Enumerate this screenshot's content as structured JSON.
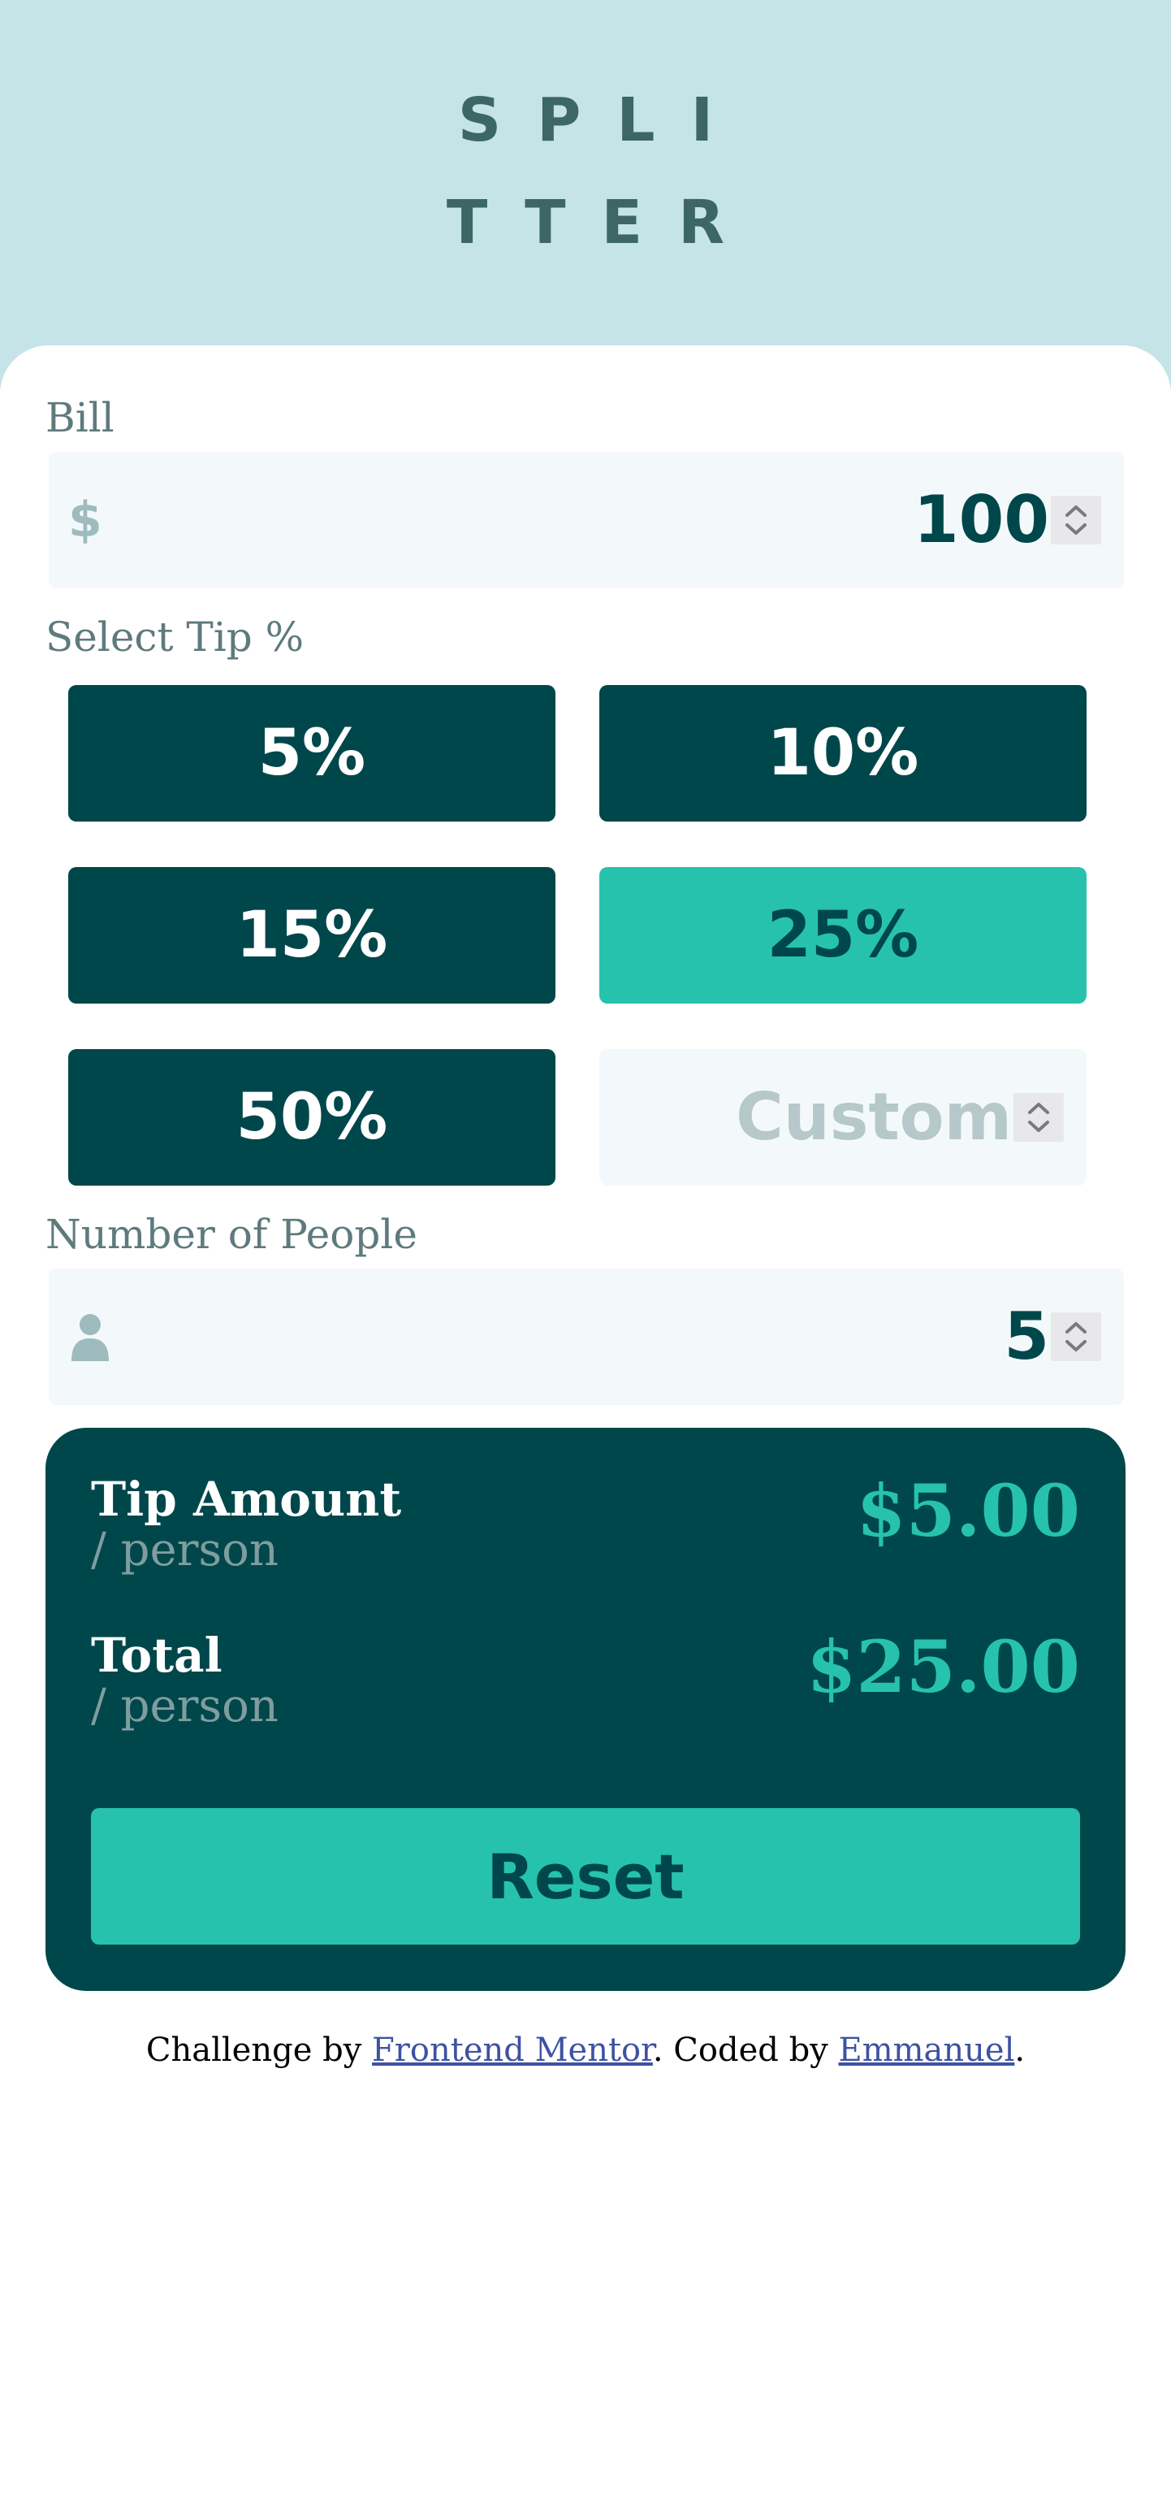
{
  "header": {
    "logo_line1": "SPLI",
    "logo_line2": "TTER"
  },
  "bill": {
    "label": "Bill",
    "prefix": "$",
    "value": "100"
  },
  "tip": {
    "label": "Select Tip %",
    "options": [
      "5%",
      "10%",
      "15%",
      "25%",
      "50%"
    ],
    "selected": "25%",
    "custom_placeholder": "Custom"
  },
  "people": {
    "label": "Number of People",
    "value": "5",
    "icon": "person-icon"
  },
  "result": {
    "tip_label": "Tip Amount",
    "tip_sub": "/ person",
    "tip_amount": "$5.00",
    "total_label": "Total",
    "total_sub": "/ person",
    "total_amount": "$25.00",
    "reset_label": "Reset"
  },
  "attribution": {
    "prefix": "Challenge by ",
    "link1": "Frontend Mentor",
    "middle": ". Coded by ",
    "link2": "Emmanuel",
    "suffix": "."
  },
  "colors": {
    "header_bg": "#c5e4e7",
    "dark_cyan": "#00474b",
    "strong_cyan": "#26c2ad",
    "input_bg": "#f3f9fa",
    "label_grey": "#5e7a7d"
  }
}
